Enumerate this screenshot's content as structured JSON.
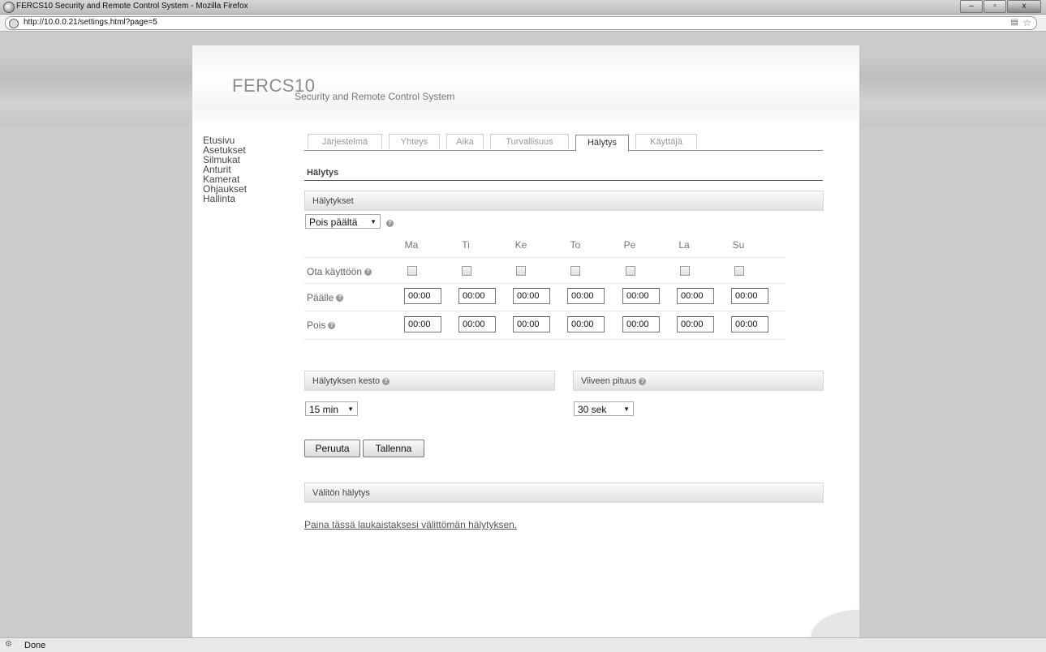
{
  "window": {
    "title": "FERCS10 Security and Remote Control System - Mozilla Firefox",
    "url": "http://10.0.0.21/settings.html?page=5",
    "buttons": {
      "minimize": "–",
      "maximize": "▫",
      "close": "x"
    }
  },
  "status": {
    "text": "Done"
  },
  "header": {
    "logo": "FERCS10",
    "subtitle": "Security and Remote Control System"
  },
  "sidebar": {
    "items": [
      {
        "label": "Etusivu"
      },
      {
        "label": "Asetukset"
      },
      {
        "label": "Silmukat"
      },
      {
        "label": "Anturit"
      },
      {
        "label": "Kamerat"
      },
      {
        "label": "Ohjaukset"
      },
      {
        "label": "Hallinta"
      }
    ]
  },
  "tabs": [
    {
      "label": "Järjestelmä"
    },
    {
      "label": "Yhteys"
    },
    {
      "label": "Aika"
    },
    {
      "label": "Turvallisuus"
    },
    {
      "label": "Hälytys",
      "active": true
    },
    {
      "label": "Käyttäjä"
    }
  ],
  "alarm": {
    "section_title": "Hälytys",
    "alarms_bar": "Hälytykset",
    "mode_select": "Pois päältä",
    "days": [
      "Ma",
      "Ti",
      "Ke",
      "To",
      "Pe",
      "La",
      "Su"
    ],
    "enable_label": "Ota käyttöön",
    "on_label": "Päälle",
    "off_label": "Pois",
    "on_times": [
      "00:00",
      "00:00",
      "00:00",
      "00:00",
      "00:00",
      "00:00",
      "00:00"
    ],
    "off_times": [
      "00:00",
      "00:00",
      "00:00",
      "00:00",
      "00:00",
      "00:00",
      "00:00"
    ],
    "duration_bar": "Hälytyksen kesto",
    "duration_select": "15 min",
    "delay_bar": "Viiveen pituus",
    "delay_select": "30 sek",
    "cancel_button": "Peruuta",
    "save_button": "Tallenna",
    "instant_bar": "Välitön hälytys",
    "instant_link": "Paina tässä laukaistaksesi välittömän hälytyksen."
  },
  "icons": {
    "help": "?",
    "dropdown": "▼"
  }
}
